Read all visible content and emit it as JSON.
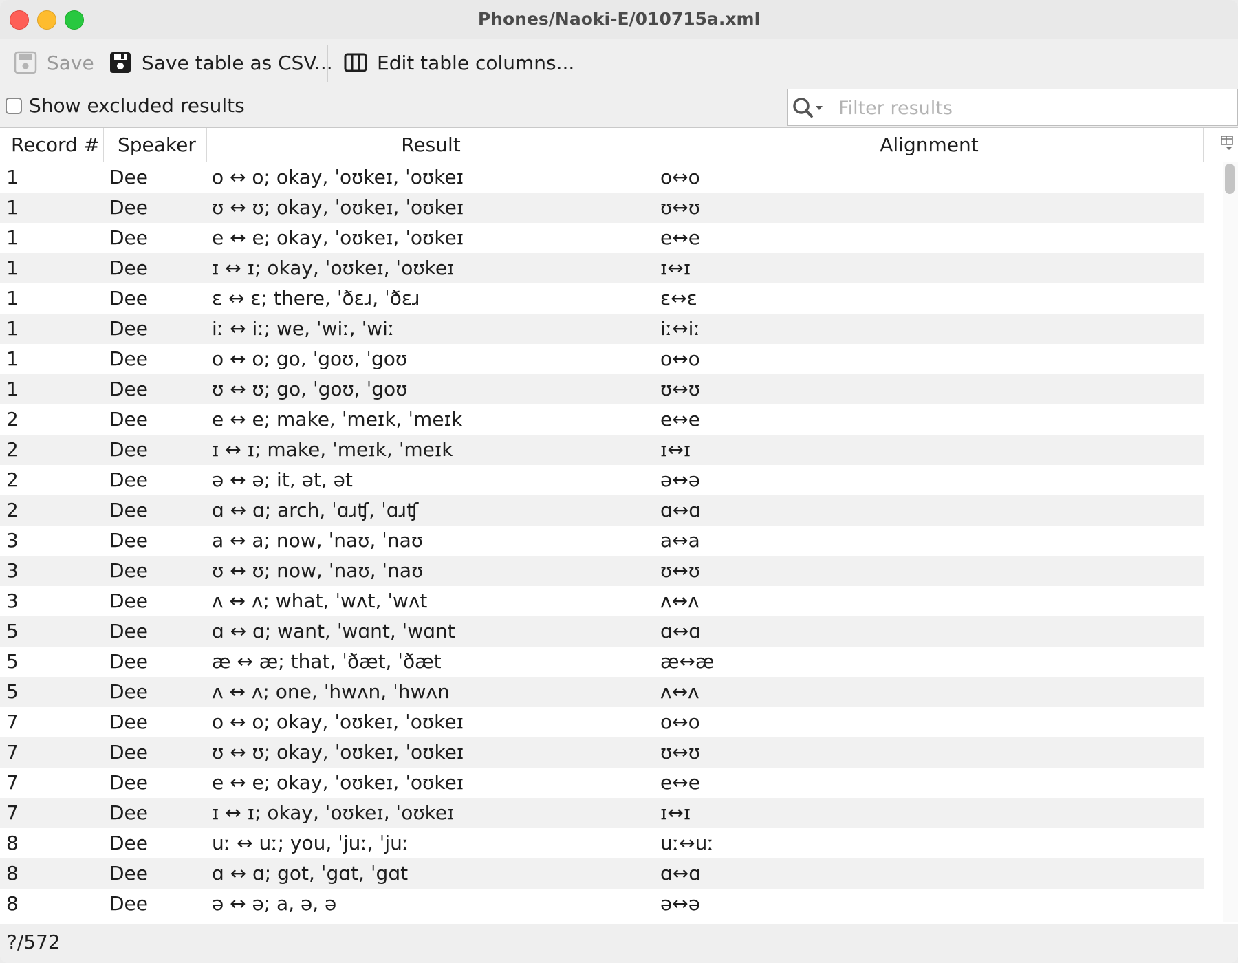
{
  "window": {
    "title": "Phones/Naoki-E/010715a.xml"
  },
  "toolbar": {
    "save_label": "Save",
    "save_csv_label": "Save table as CSV...",
    "edit_columns_label": "Edit table columns..."
  },
  "filter": {
    "show_excluded_label": "Show excluded results",
    "show_excluded_checked": false,
    "search_placeholder": "Filter results",
    "search_value": ""
  },
  "table": {
    "columns": [
      "Record #",
      "Speaker",
      "Result",
      "Alignment"
    ],
    "rows": [
      {
        "record": "1",
        "speaker": "Dee",
        "result": "o ↔ o; okay, ˈoʊkeɪ, ˈoʊkeɪ",
        "alignment": "o↔o"
      },
      {
        "record": "1",
        "speaker": "Dee",
        "result": "ʊ ↔ ʊ; okay, ˈoʊkeɪ, ˈoʊkeɪ",
        "alignment": "ʊ↔ʊ"
      },
      {
        "record": "1",
        "speaker": "Dee",
        "result": "e ↔ e; okay, ˈoʊkeɪ, ˈoʊkeɪ",
        "alignment": "e↔e"
      },
      {
        "record": "1",
        "speaker": "Dee",
        "result": "ɪ ↔ ɪ; okay, ˈoʊkeɪ, ˈoʊkeɪ",
        "alignment": "ɪ↔ɪ"
      },
      {
        "record": "1",
        "speaker": "Dee",
        "result": "ɛ ↔ ɛ; there, ˈðɛɹ, ˈðɛɹ",
        "alignment": "ɛ↔ɛ"
      },
      {
        "record": "1",
        "speaker": "Dee",
        "result": "iː ↔ iː; we, ˈwiː, ˈwiː",
        "alignment": "iː↔iː"
      },
      {
        "record": "1",
        "speaker": "Dee",
        "result": "o ↔ o; go, ˈgoʊ, ˈgoʊ",
        "alignment": "o↔o"
      },
      {
        "record": "1",
        "speaker": "Dee",
        "result": "ʊ ↔ ʊ; go, ˈgoʊ, ˈgoʊ",
        "alignment": "ʊ↔ʊ"
      },
      {
        "record": "2",
        "speaker": "Dee",
        "result": "e ↔ e; make, ˈmeɪk, ˈmeɪk",
        "alignment": "e↔e"
      },
      {
        "record": "2",
        "speaker": "Dee",
        "result": "ɪ ↔ ɪ; make, ˈmeɪk, ˈmeɪk",
        "alignment": "ɪ↔ɪ"
      },
      {
        "record": "2",
        "speaker": "Dee",
        "result": "ə ↔ ə; it, ət, ət",
        "alignment": "ə↔ə"
      },
      {
        "record": "2",
        "speaker": "Dee",
        "result": "ɑ ↔ ɑ; arch, ˈɑɹʧ, ˈɑɹʧ",
        "alignment": "ɑ↔ɑ"
      },
      {
        "record": "3",
        "speaker": "Dee",
        "result": "a ↔ a; now, ˈnaʊ, ˈnaʊ",
        "alignment": "a↔a"
      },
      {
        "record": "3",
        "speaker": "Dee",
        "result": "ʊ ↔ ʊ; now, ˈnaʊ, ˈnaʊ",
        "alignment": "ʊ↔ʊ"
      },
      {
        "record": "3",
        "speaker": "Dee",
        "result": "ʌ ↔ ʌ; what, ˈwʌt, ˈwʌt",
        "alignment": "ʌ↔ʌ"
      },
      {
        "record": "5",
        "speaker": "Dee",
        "result": "ɑ ↔ ɑ; want, ˈwɑnt, ˈwɑnt",
        "alignment": "ɑ↔ɑ"
      },
      {
        "record": "5",
        "speaker": "Dee",
        "result": "æ ↔ æ; that, ˈðæt, ˈðæt",
        "alignment": "æ↔æ"
      },
      {
        "record": "5",
        "speaker": "Dee",
        "result": "ʌ ↔ ʌ; one, ˈhwʌn, ˈhwʌn",
        "alignment": "ʌ↔ʌ"
      },
      {
        "record": "7",
        "speaker": "Dee",
        "result": "o ↔ o; okay, ˈoʊkeɪ, ˈoʊkeɪ",
        "alignment": "o↔o"
      },
      {
        "record": "7",
        "speaker": "Dee",
        "result": "ʊ ↔ ʊ; okay, ˈoʊkeɪ, ˈoʊkeɪ",
        "alignment": "ʊ↔ʊ"
      },
      {
        "record": "7",
        "speaker": "Dee",
        "result": "e ↔ e; okay, ˈoʊkeɪ, ˈoʊkeɪ",
        "alignment": "e↔e"
      },
      {
        "record": "7",
        "speaker": "Dee",
        "result": "ɪ ↔ ɪ; okay, ˈoʊkeɪ, ˈoʊkeɪ",
        "alignment": "ɪ↔ɪ"
      },
      {
        "record": "8",
        "speaker": "Dee",
        "result": "uː ↔ uː; you, ˈjuː, ˈjuː",
        "alignment": "uː↔uː"
      },
      {
        "record": "8",
        "speaker": "Dee",
        "result": "ɑ ↔ ɑ; got, ˈgɑt, ˈgɑt",
        "alignment": "ɑ↔ɑ"
      },
      {
        "record": "8",
        "speaker": "Dee",
        "result": "ə ↔ ə; a, ə, ə",
        "alignment": "ə↔ə"
      }
    ]
  },
  "status": {
    "text": "?/572"
  },
  "icons": {
    "save": "save-icon",
    "save_csv": "floppy-disk-icon",
    "edit_columns": "columns-icon",
    "search": "search-icon",
    "column_menu": "column-menu-icon"
  },
  "colors": {
    "close": "#fe5f57",
    "minimize": "#febc2e",
    "zoom": "#28c840",
    "row_alt": "#f1f1f1"
  }
}
